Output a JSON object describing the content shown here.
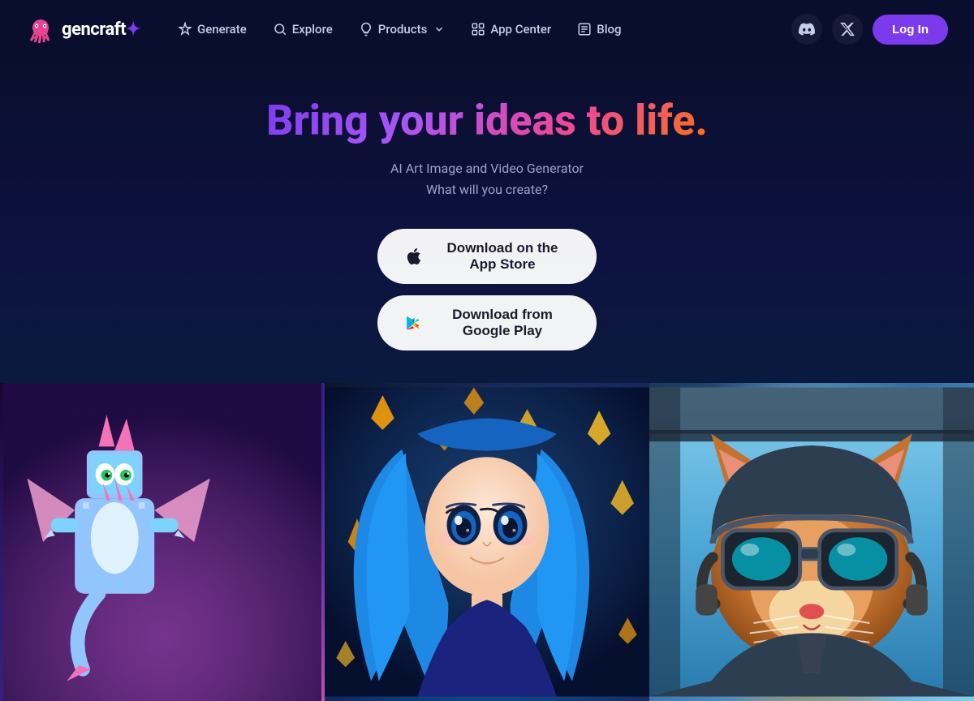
{
  "logo": {
    "brand": "gencraft",
    "brand_suffix": "✦"
  },
  "nav": {
    "generate_label": "Generate",
    "explore_label": "Explore",
    "products_label": "Products",
    "app_center_label": "App Center",
    "blog_label": "Blog",
    "login_label": "Log In"
  },
  "hero": {
    "title": "Bring your ideas to life.",
    "subtitle_line1": "AI Art Image and Video Generator",
    "subtitle_line2": "What will you create?",
    "appstore_label": "Download on the App Store",
    "googleplay_label": "Download from Google Play"
  },
  "images": [
    {
      "alt": "Pixel art blue dragon",
      "type": "dragon"
    },
    {
      "alt": "Anime girl with blue hair and golden gems",
      "type": "girl"
    },
    {
      "alt": "Cat wearing pilot goggles",
      "type": "cat"
    }
  ]
}
